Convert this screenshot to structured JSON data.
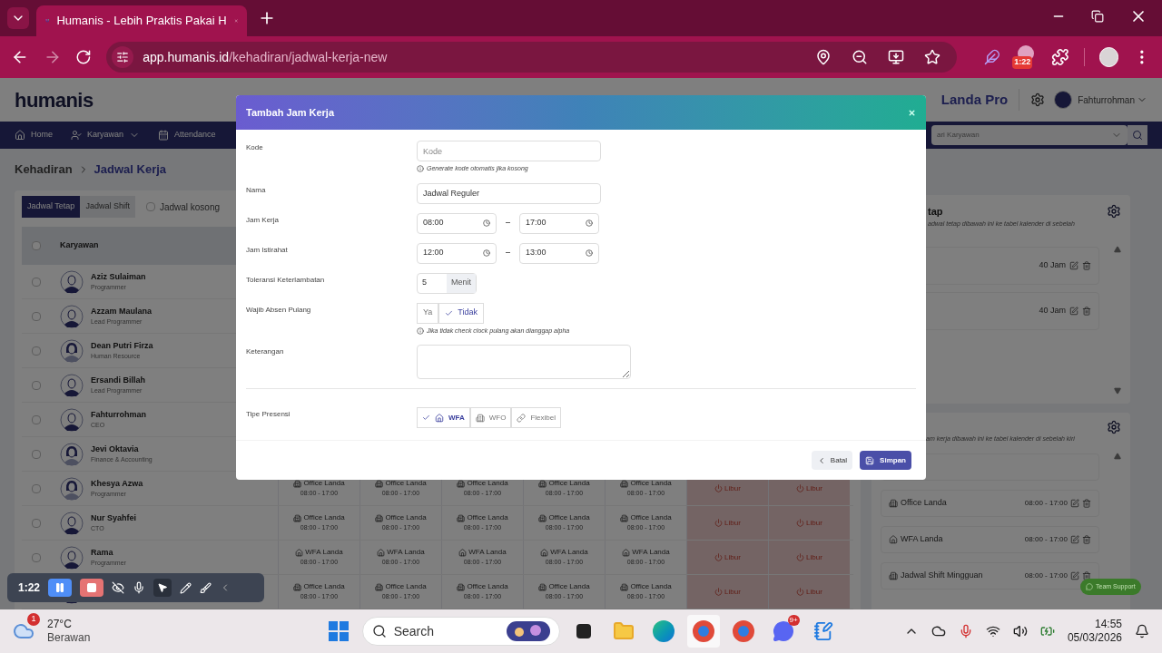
{
  "browser": {
    "tab_title": "Humanis - Lebih Praktis Pakai H",
    "url_host": "app.humanis.id",
    "url_path": "/kehadiran/jadwal-kerja-new",
    "extension_badge": "1:22"
  },
  "header": {
    "logo": "humanis",
    "company": "Landa Pro",
    "user": "Fahturrohman"
  },
  "nav": {
    "items": [
      {
        "label": "Home"
      },
      {
        "label": "Karyawan",
        "dropdown": true
      },
      {
        "label": "Attendance"
      }
    ],
    "search_placeholder": "ari Karyawan"
  },
  "breadcrumb": [
    "Kehadiran",
    "Jadwal Kerja"
  ],
  "schedule_tabs": [
    {
      "label": "Jadwal Tetap",
      "selected": true
    },
    {
      "label": "Jadwal Shift",
      "selected": false
    }
  ],
  "empty_filter": {
    "label": "Jadwal kosong",
    "checked": false
  },
  "table": {
    "column": "Karyawan",
    "header_checked": false,
    "rows": [
      {
        "name": "Aziz Sulaiman",
        "role": "Programmer",
        "kind": "male",
        "checked": false
      },
      {
        "name": "Azzam Maulana",
        "role": "Lead Programmer",
        "kind": "male",
        "checked": false
      },
      {
        "name": "Dean Putri Firza",
        "role": "Human Resource",
        "kind": "female",
        "checked": false
      },
      {
        "name": "Ersandi Billah",
        "role": "Lead Programmer",
        "kind": "male",
        "checked": false
      },
      {
        "name": "Fahturrohman",
        "role": "CEO",
        "kind": "male",
        "checked": false
      },
      {
        "name": "Jevi Oktavia",
        "role": "Finance & Accounting",
        "kind": "female",
        "checked": false
      },
      {
        "name": "Khesya Azwa",
        "role": "Programmer",
        "kind": "female",
        "checked": false,
        "cells": [
          {
            "kind": "office",
            "label": "Office Landa",
            "time": "08:00 - 17:00"
          },
          {
            "kind": "office",
            "label": "Office Landa",
            "time": "08:00 - 17:00"
          },
          {
            "kind": "office",
            "label": "Office Landa",
            "time": "08:00 - 17:00"
          },
          {
            "kind": "office",
            "label": "Office Landa",
            "time": "08:00 - 17:00"
          },
          {
            "kind": "office",
            "label": "Office Landa",
            "time": "08:00 - 17:00"
          },
          {
            "kind": "off",
            "label": "Libur"
          },
          {
            "kind": "off",
            "label": "Libur"
          }
        ]
      },
      {
        "name": "Nur Syahfei",
        "role": "CTO",
        "kind": "male",
        "checked": false,
        "cells": [
          {
            "kind": "office",
            "label": "Office Landa",
            "time": "08:00 - 17:00"
          },
          {
            "kind": "office",
            "label": "Office Landa",
            "time": "08:00 - 17:00"
          },
          {
            "kind": "office",
            "label": "Office Landa",
            "time": "08:00 - 17:00"
          },
          {
            "kind": "office",
            "label": "Office Landa",
            "time": "08:00 - 17:00"
          },
          {
            "kind": "office",
            "label": "Office Landa",
            "time": "08:00 - 17:00"
          },
          {
            "kind": "off",
            "label": "Libur"
          },
          {
            "kind": "off",
            "label": "Libur"
          }
        ]
      },
      {
        "name": "Rama",
        "role": "Programmer",
        "kind": "male",
        "checked": false,
        "cells": [
          {
            "kind": "wfa",
            "label": "WFA Landa",
            "time": "08:00 - 17:00"
          },
          {
            "kind": "wfa",
            "label": "WFA Landa",
            "time": "08:00 - 17:00"
          },
          {
            "kind": "wfa",
            "label": "WFA Landa",
            "time": "08:00 - 17:00"
          },
          {
            "kind": "wfa",
            "label": "WFA Landa",
            "time": "08:00 - 17:00"
          },
          {
            "kind": "wfa",
            "label": "WFA Landa",
            "time": "08:00 - 17:00"
          },
          {
            "kind": "off",
            "label": "Libur"
          },
          {
            "kind": "off",
            "label": "Libur"
          }
        ]
      },
      {
        "kind": "male",
        "cells": [
          {
            "kind": "office",
            "label": "Office Landa",
            "time": "08:00 - 17:00"
          },
          {
            "kind": "office",
            "label": "Office Landa",
            "time": "08:00 - 17:00"
          },
          {
            "kind": "office",
            "label": "Office Landa",
            "time": "08:00 - 17:00"
          },
          {
            "kind": "office",
            "label": "Office Landa",
            "time": "08:00 - 17:00"
          },
          {
            "kind": "office",
            "label": "Office Landa",
            "time": "08:00 - 17:00"
          },
          {
            "kind": "off",
            "label": "Libur"
          },
          {
            "kind": "off",
            "label": "Libur"
          }
        ]
      }
    ]
  },
  "right_panel": {
    "fixed": {
      "title": "tap",
      "hint": "adwal tetap dibawah ini ke tabel kalender di sebelah",
      "items": [
        {
          "hours": "40 Jam"
        },
        {
          "hours": "40 Jam"
        }
      ]
    },
    "hours": {
      "hint": "am kerja dibawah ini ke tabel kalender di sebelah kiri",
      "items": [
        {
          "kind": "office",
          "name": "Office Landa",
          "time": "08:00 - 17:00"
        },
        {
          "kind": "wfa",
          "name": "WFA Landa",
          "time": "08:00 - 17:00"
        },
        {
          "kind": "office",
          "name": "Jadwal Shift Mingguan",
          "time": "08:00 - 17:00"
        }
      ]
    }
  },
  "modal": {
    "title": "Tambah Jam Kerja",
    "fields": [
      {
        "kind": "text",
        "label": "Kode",
        "placeholder": "Kode",
        "hint": "Generate kode otomatis jika kosong"
      },
      {
        "kind": "text",
        "label": "Nama",
        "value": "Jadwal Reguler"
      },
      {
        "kind": "time_range",
        "label": "Jam Kerja",
        "from": "08:00",
        "separator": "–",
        "to": "17:00"
      },
      {
        "kind": "time_range",
        "label": "Jam Istirahat",
        "from": "12:00",
        "separator": "–",
        "to": "13:00"
      },
      {
        "kind": "addon",
        "label": "Toleransi Keterlambatan",
        "value": "5",
        "addon": "Menit"
      },
      {
        "kind": "toggle",
        "label": "Wajib Absen Pulang",
        "options": [
          {
            "label": "Ya",
            "selected": false
          },
          {
            "label": "Tidak",
            "selected": true
          }
        ],
        "hint": "Jika tidak check clock pulang akan dianggap alpha"
      },
      {
        "kind": "textarea",
        "label": "Keterangan"
      },
      {
        "kind": "divider"
      },
      {
        "kind": "presence",
        "label": "Tipe Presensi",
        "options": [
          {
            "label": "WFA",
            "kind": "wfa",
            "selected": true
          },
          {
            "label": "WFO",
            "kind": "office",
            "selected": false
          },
          {
            "label": "Flexibel",
            "kind": "flex",
            "selected": false
          }
        ]
      }
    ],
    "cancel": "Batal",
    "save": "Simpan"
  },
  "support_button": "Team Support",
  "recorder": {
    "time": "1:22"
  },
  "taskbar": {
    "weather_badge": "1",
    "temperature": "27°C",
    "condition": "Berawan",
    "search": "Search",
    "discord_badge": "9+",
    "time": "14:55",
    "date": "05/03/2026"
  }
}
